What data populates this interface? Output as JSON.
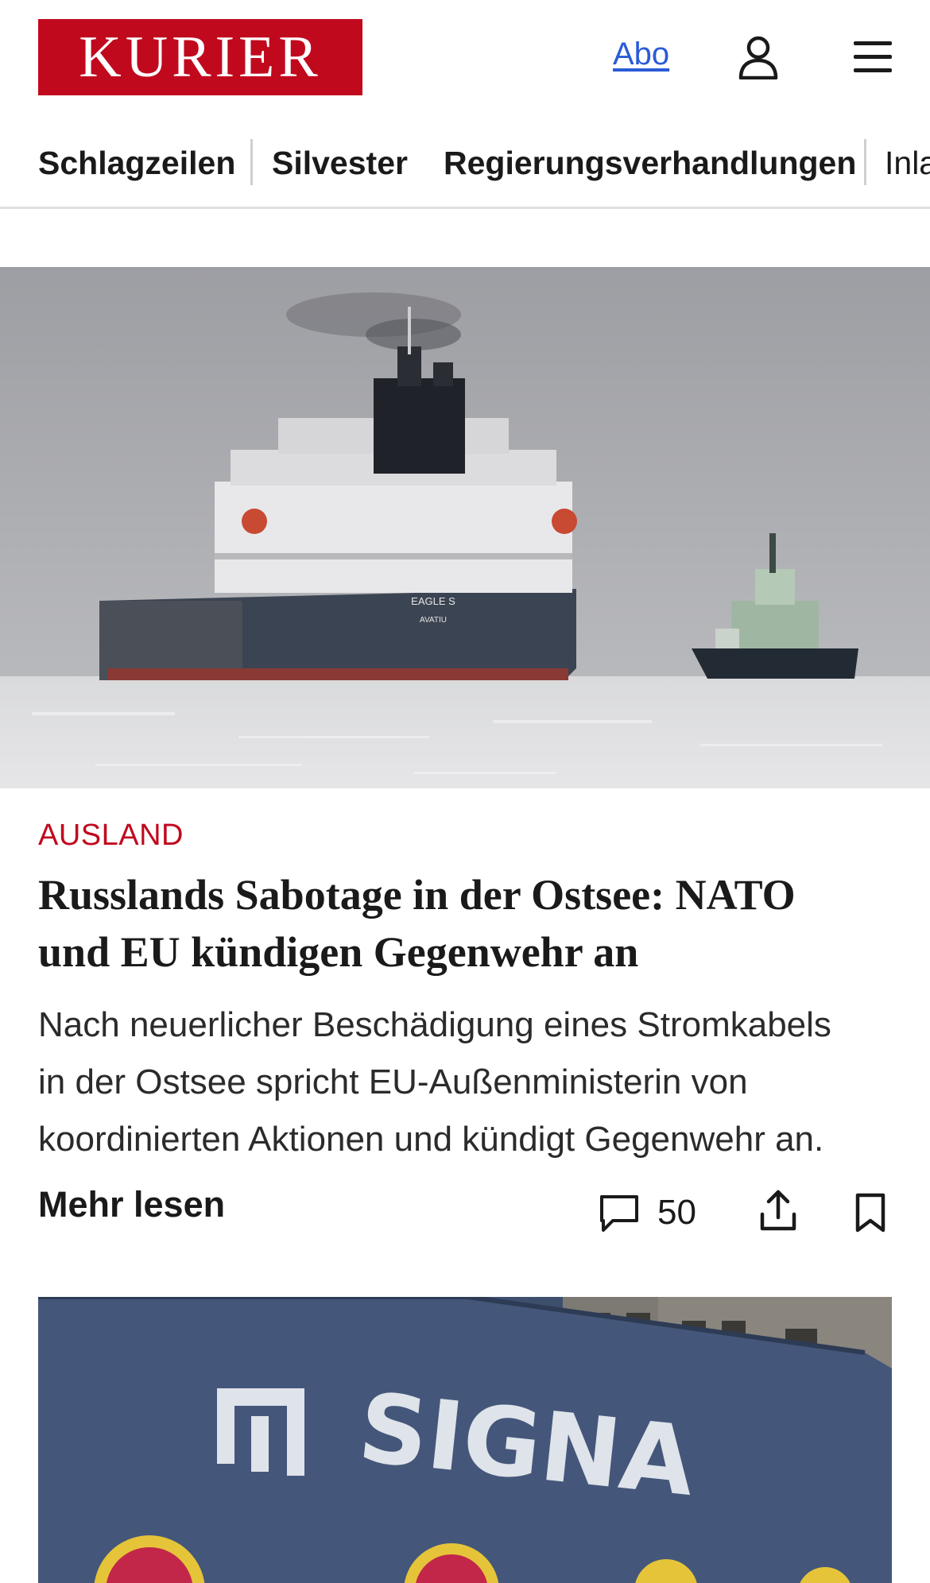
{
  "header": {
    "logo_text": "KURIER",
    "abo_label": "Abo",
    "account_icon": "user-icon",
    "menu_icon": "hamburger-menu-icon"
  },
  "nav": {
    "items": [
      {
        "label": "Schlagzeilen"
      },
      {
        "label": "Silvester"
      },
      {
        "label": "Regierungsverhandlungen"
      },
      {
        "label": "Inla"
      }
    ]
  },
  "article": {
    "category": "AUSLAND",
    "headline_line1": "Russlands Sabotage in der Ostsee: NATO",
    "headline_line2": "und EU kündigen Gegenwehr an",
    "teaser_line1": "Nach neuerlicher Beschädigung eines Stromkabels",
    "teaser_line2": "in der Ostsee spricht EU-Außenministerin von",
    "teaser_line3": "koordinierten Aktionen und kündigt Gegenwehr an.",
    "more_label": "Mehr lesen",
    "comment_count": "50",
    "image_ship_name": "EAGLE S",
    "image_ship_port": "AVATIU"
  },
  "second_article": {
    "image_text": "SIGNA"
  },
  "colors": {
    "brand": "#c1091e",
    "link": "#2a5bd7"
  }
}
